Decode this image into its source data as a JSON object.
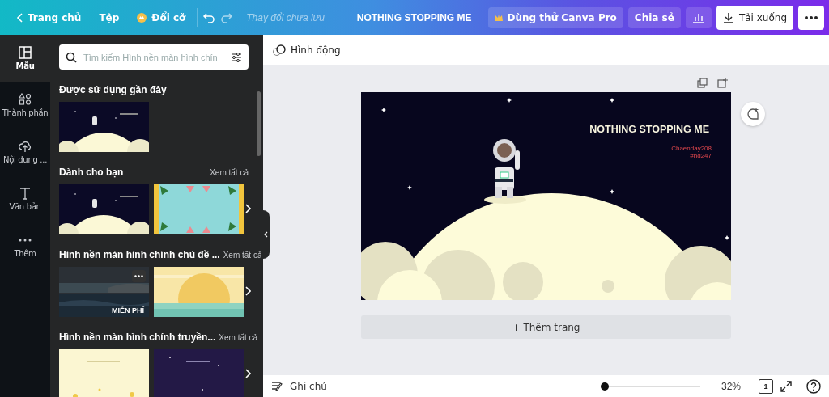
{
  "topbar": {
    "back": "Trang chủ",
    "file": "Tệp",
    "resize": "Đổi cỡ",
    "status": "Thay đổi chưa lưu",
    "title": "NOTHING STOPPING ME",
    "pro": "Dùng thử Canva Pro",
    "share": "Chia sẻ",
    "download": "Tải xuống"
  },
  "rail": [
    {
      "kind": "template",
      "label": "Mẫu",
      "selected": true
    },
    {
      "kind": "elements",
      "label": "Thành phần",
      "selected": false
    },
    {
      "kind": "upload",
      "label": "Nội dung ...",
      "selected": false
    },
    {
      "kind": "text",
      "label": "Văn bản",
      "selected": false
    },
    {
      "kind": "more",
      "label": "Thêm",
      "selected": false
    }
  ],
  "search": {
    "placeholder": "Tìm kiếm Hình nền màn hình chín"
  },
  "sections": [
    {
      "title": "Được sử dụng gần đây",
      "thumbs": [
        {
          "kind": "space"
        }
      ]
    },
    {
      "title": "Dành cho bạn",
      "see_all": "Xem tất cả",
      "thumbs": [
        {
          "kind": "space"
        },
        {
          "kind": "watermelon"
        }
      ]
    },
    {
      "title": "Hình nền màn hình chính chủ đề ...",
      "see_all": "Xem tất cả",
      "thumbs": [
        {
          "kind": "sea",
          "badge": "MIỄN PHÍ",
          "menu": true
        },
        {
          "kind": "sunset"
        }
      ]
    },
    {
      "title": "Hình nền màn hình chính truyền...",
      "see_all": "Xem tất cả",
      "thumbs": [
        {
          "kind": "cream"
        },
        {
          "kind": "night"
        }
      ]
    }
  ],
  "editor": {
    "animate": "Hình động"
  },
  "design": {
    "title": "NOTHING STOPPING ME",
    "lines": [
      "Chaenday208",
      "#hd247"
    ]
  },
  "add_page": "+ Thêm trang",
  "bottom": {
    "notes": "Ghi chú",
    "zoom": {
      "level": 0.0
    },
    "zoom_reading": "32%",
    "page_count": "1"
  }
}
